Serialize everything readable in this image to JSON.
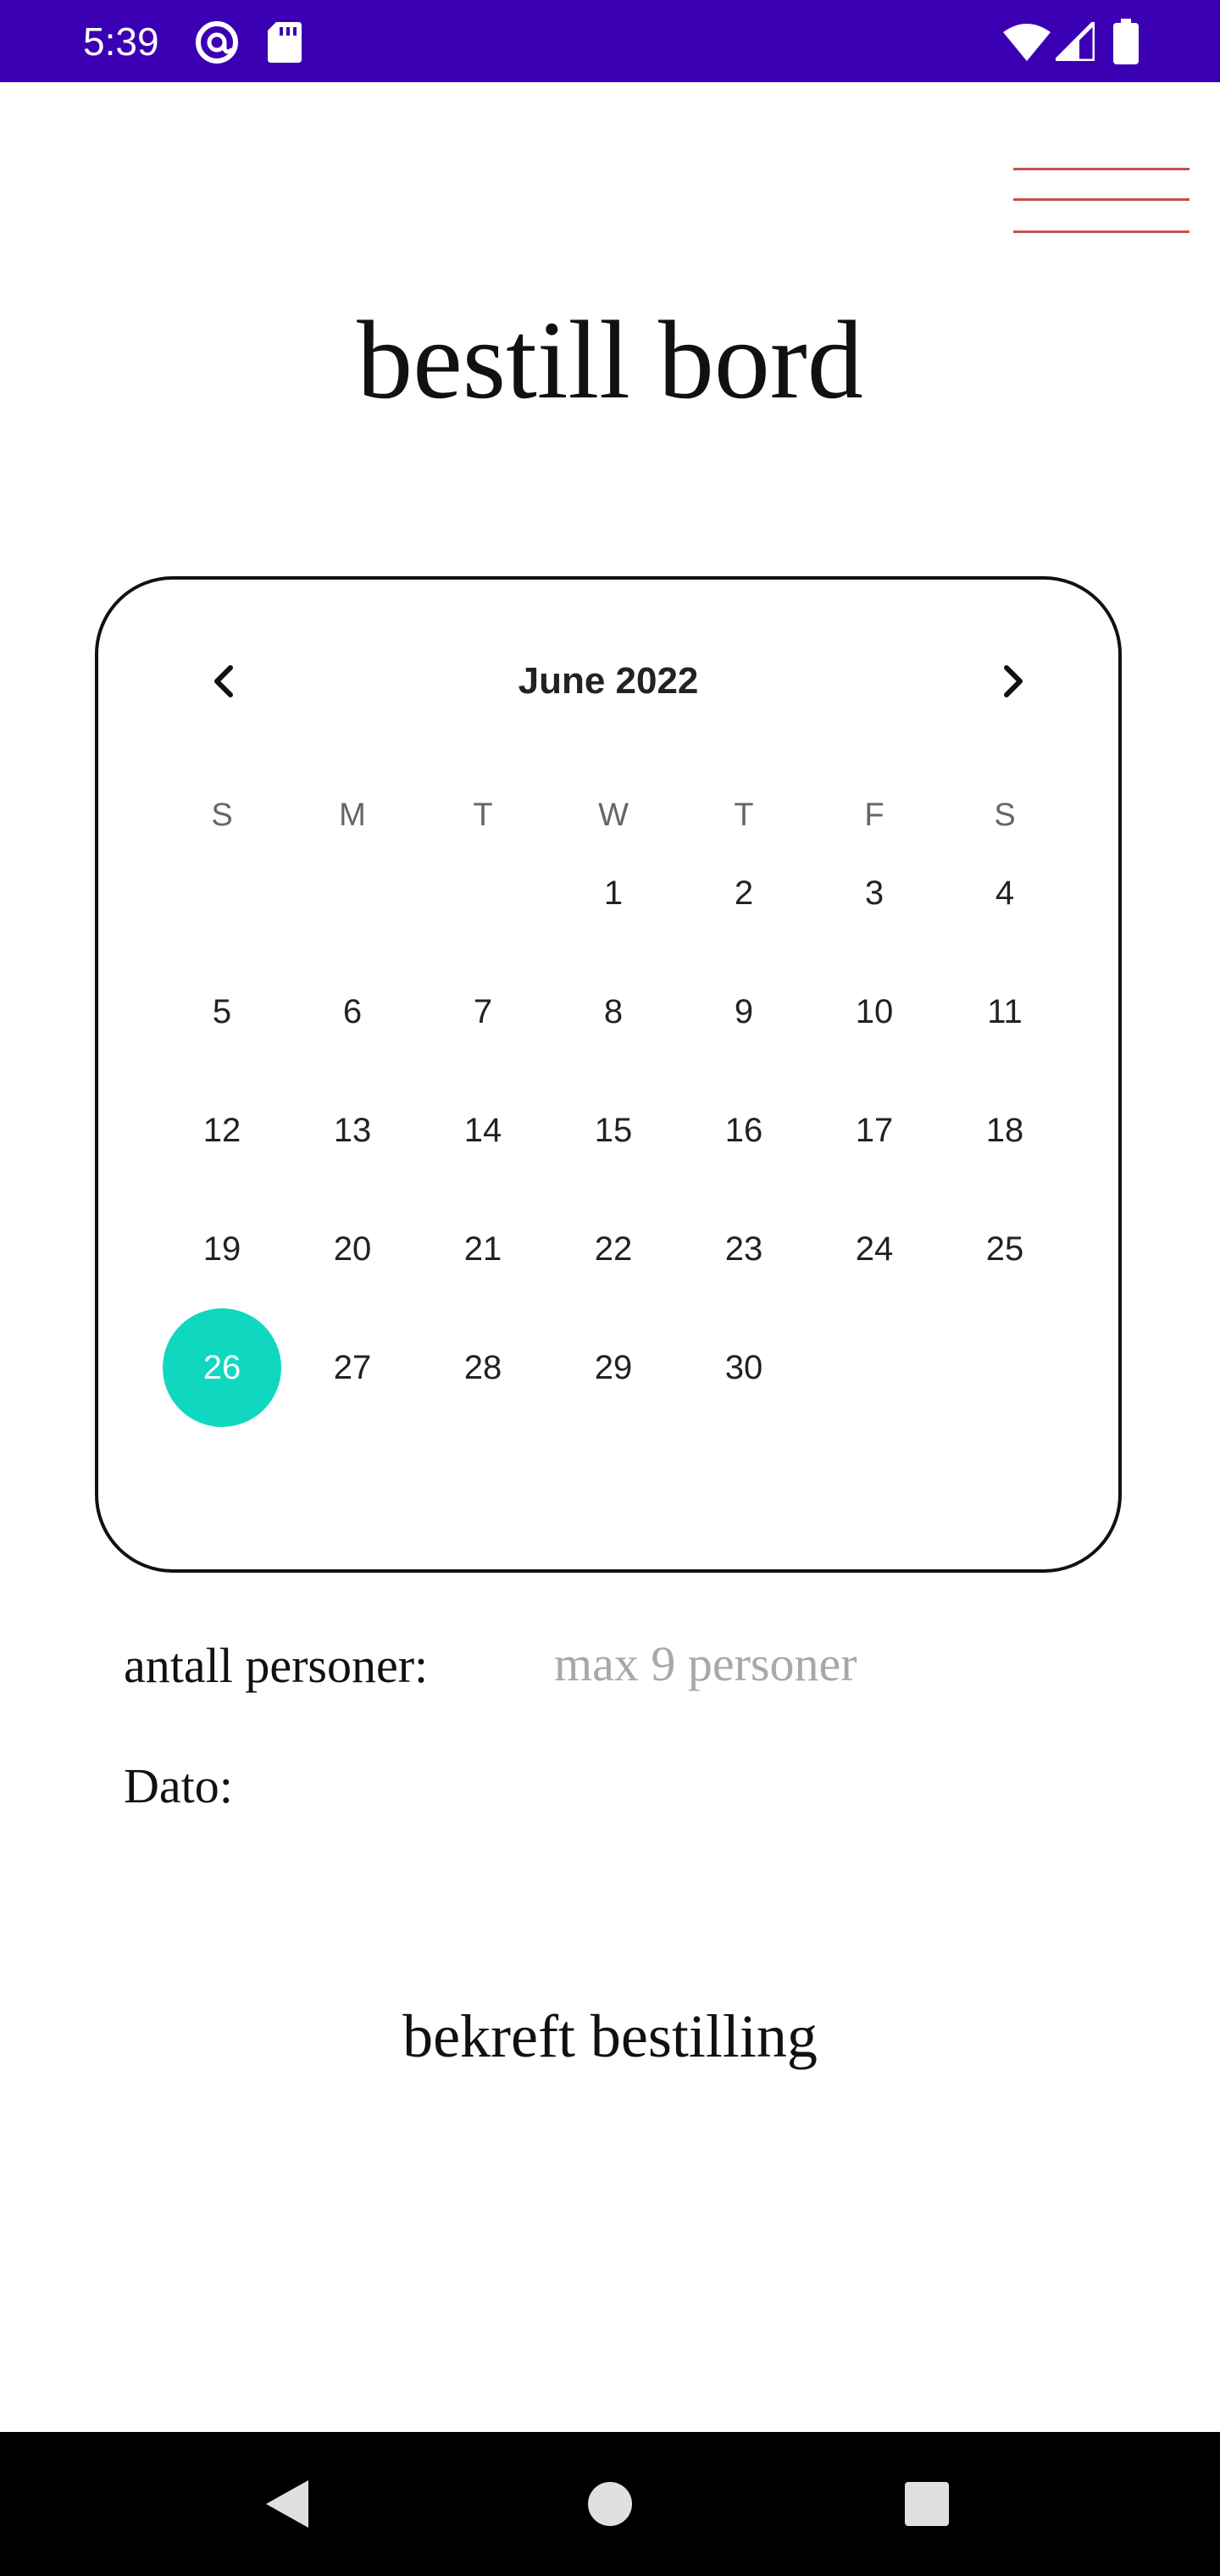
{
  "status_bar": {
    "time": "5:39",
    "left_icons": [
      "at-sign-icon",
      "sd-card-icon"
    ],
    "right_icons": [
      "wifi-icon",
      "cell-signal-icon",
      "battery-icon"
    ],
    "background": "#3c00b4"
  },
  "header": {
    "menu_icon": "hamburger-menu-icon",
    "menu_color": "#c85050",
    "title": "bestill bord"
  },
  "calendar": {
    "month_label": "June 2022",
    "prev_icon": "chevron-left-icon",
    "next_icon": "chevron-right-icon",
    "weekdays": [
      "S",
      "M",
      "T",
      "W",
      "T",
      "F",
      "S"
    ],
    "first_weekday_index": 3,
    "days": [
      "1",
      "2",
      "3",
      "4",
      "5",
      "6",
      "7",
      "8",
      "9",
      "10",
      "11",
      "12",
      "13",
      "14",
      "15",
      "16",
      "17",
      "18",
      "19",
      "20",
      "21",
      "22",
      "23",
      "24",
      "25",
      "26",
      "27",
      "28",
      "29",
      "30"
    ],
    "selected_day": "26",
    "selected_color": "#10d8c0"
  },
  "form": {
    "persons_label": "antall personer:",
    "persons_placeholder": "max 9 personer",
    "persons_value": "",
    "date_label": "Dato:",
    "date_value": ""
  },
  "actions": {
    "confirm_label": "bekreft bestilling"
  },
  "nav_bar": {
    "icons": [
      "back-triangle-icon",
      "home-circle-icon",
      "recents-square-icon"
    ]
  }
}
